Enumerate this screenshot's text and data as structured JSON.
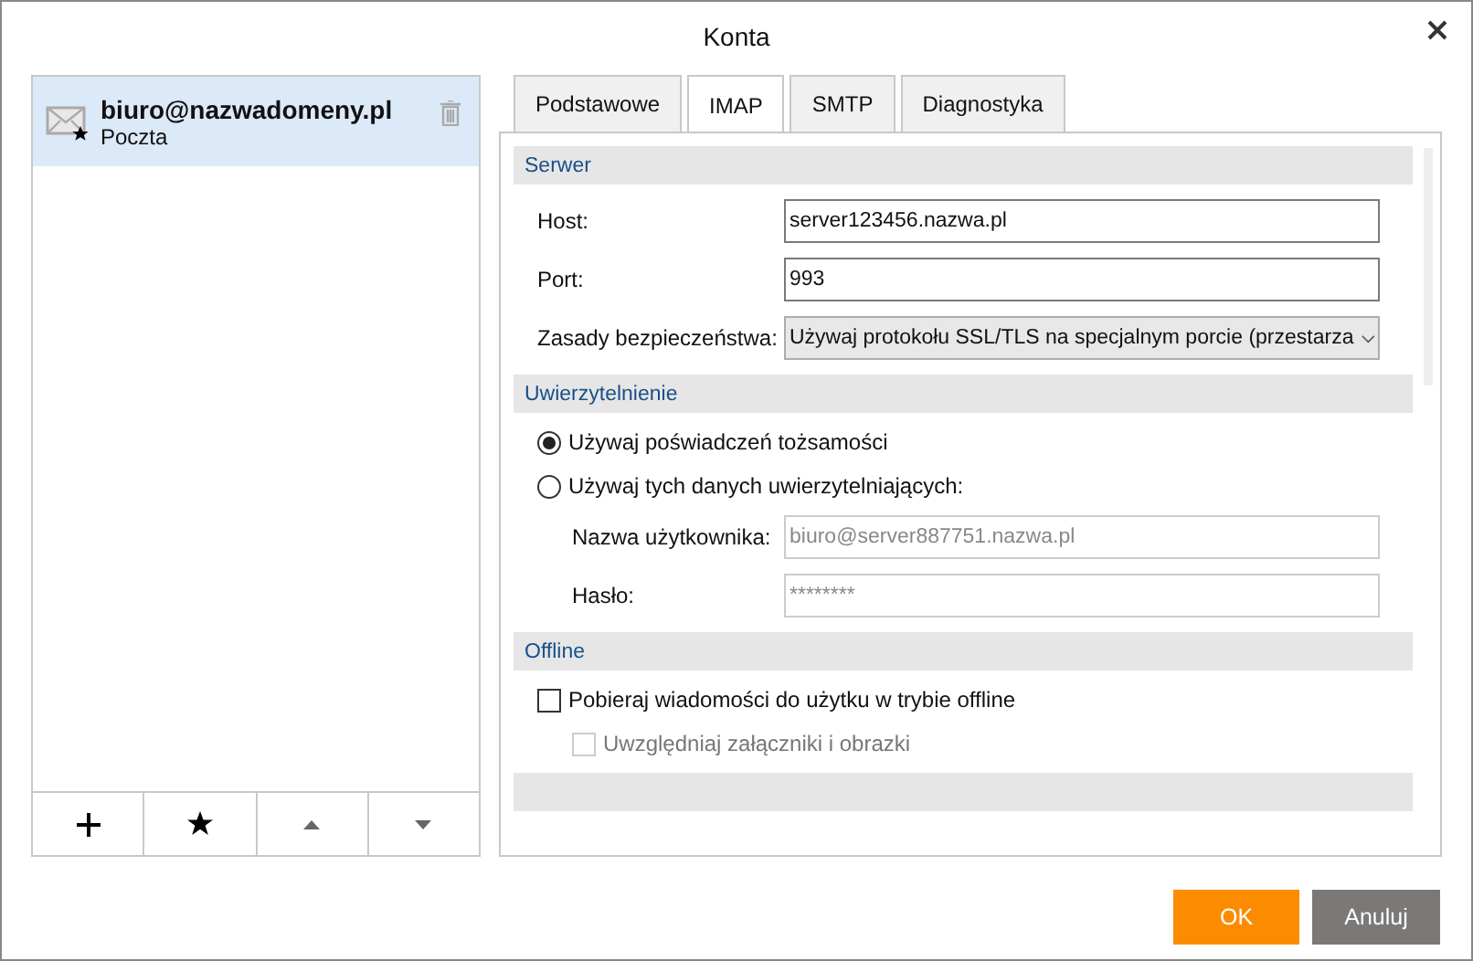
{
  "window": {
    "title": "Konta"
  },
  "accounts": [
    {
      "email": "biuro@nazwadomeny.pl",
      "type": "Poczta",
      "selected": true
    }
  ],
  "account_toolbar": [
    {
      "kind": "add"
    },
    {
      "kind": "star"
    },
    {
      "kind": "up"
    },
    {
      "kind": "down"
    }
  ],
  "tabs": [
    {
      "label": "Podstawowe",
      "selected": false
    },
    {
      "label": "IMAP",
      "selected": true
    },
    {
      "label": "SMTP",
      "selected": false
    },
    {
      "label": "Diagnostyka",
      "selected": false
    }
  ],
  "sections": [
    {
      "title": "Serwer",
      "rows": [
        {
          "kind": "text",
          "label": "Host:",
          "value": "server123456.nazwa.pl",
          "disabled": false
        },
        {
          "kind": "text",
          "label": "Port:",
          "value": "993",
          "disabled": false
        },
        {
          "kind": "select",
          "label": "Zasady bezpieczeństwa:",
          "value": "Używaj protokołu SSL/TLS na specjalnym porcie (przestarza",
          "disabled": false
        }
      ]
    },
    {
      "title": "Uwierzytelnienie",
      "rows": [
        {
          "kind": "radio",
          "label": "Używaj poświadczeń tożsamości",
          "selected": true
        },
        {
          "kind": "radio",
          "label": "Używaj tych danych uwierzytelniających:",
          "selected": false
        },
        {
          "kind": "text",
          "label": "Nazwa użytkownika:",
          "value": "biuro@server887751.nazwa.pl",
          "disabled": true
        },
        {
          "kind": "text",
          "label": "Hasło:",
          "value": "********",
          "disabled": true
        }
      ]
    },
    {
      "title": "Offline",
      "rows": [
        {
          "kind": "checkbox",
          "label": "Pobieraj wiadomości do użytku w trybie offline",
          "checked": false,
          "disabled": false
        },
        {
          "kind": "checkbox",
          "label": "Uwzględniaj załączniki i obrazki",
          "checked": false,
          "disabled": true
        }
      ]
    }
  ],
  "buttons": [
    {
      "label": "OK",
      "kind": "primary"
    },
    {
      "label": "Anuluj",
      "kind": "secondary"
    }
  ]
}
